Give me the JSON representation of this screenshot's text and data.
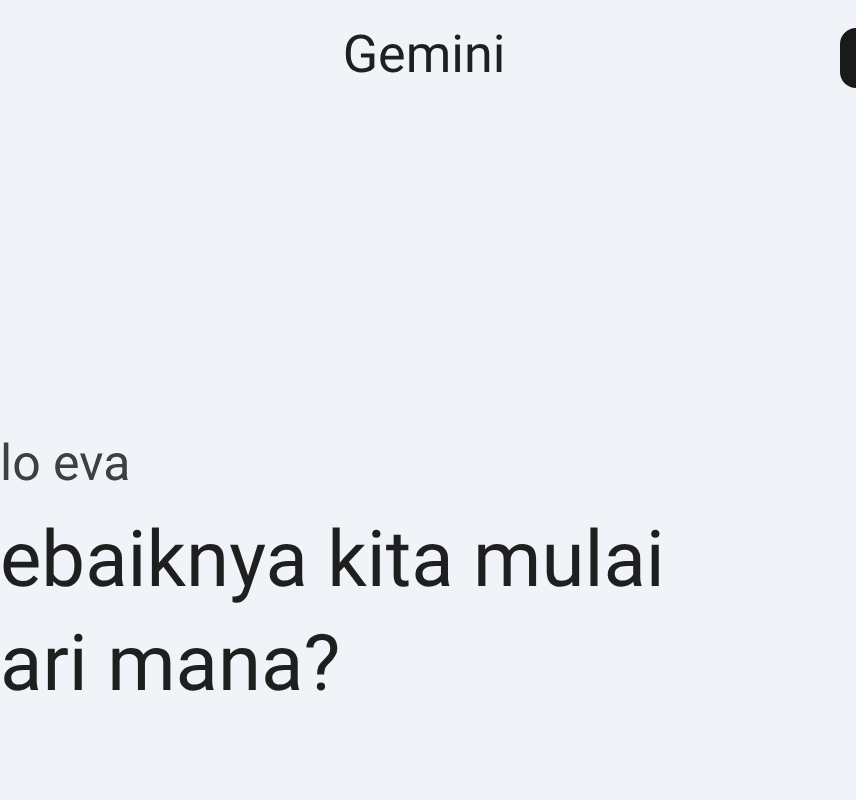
{
  "header": {
    "title": "Gemini"
  },
  "greeting": "lo eva",
  "prompt_lines": [
    "ebaiknya kita mulai",
    "ari mana?"
  ]
}
